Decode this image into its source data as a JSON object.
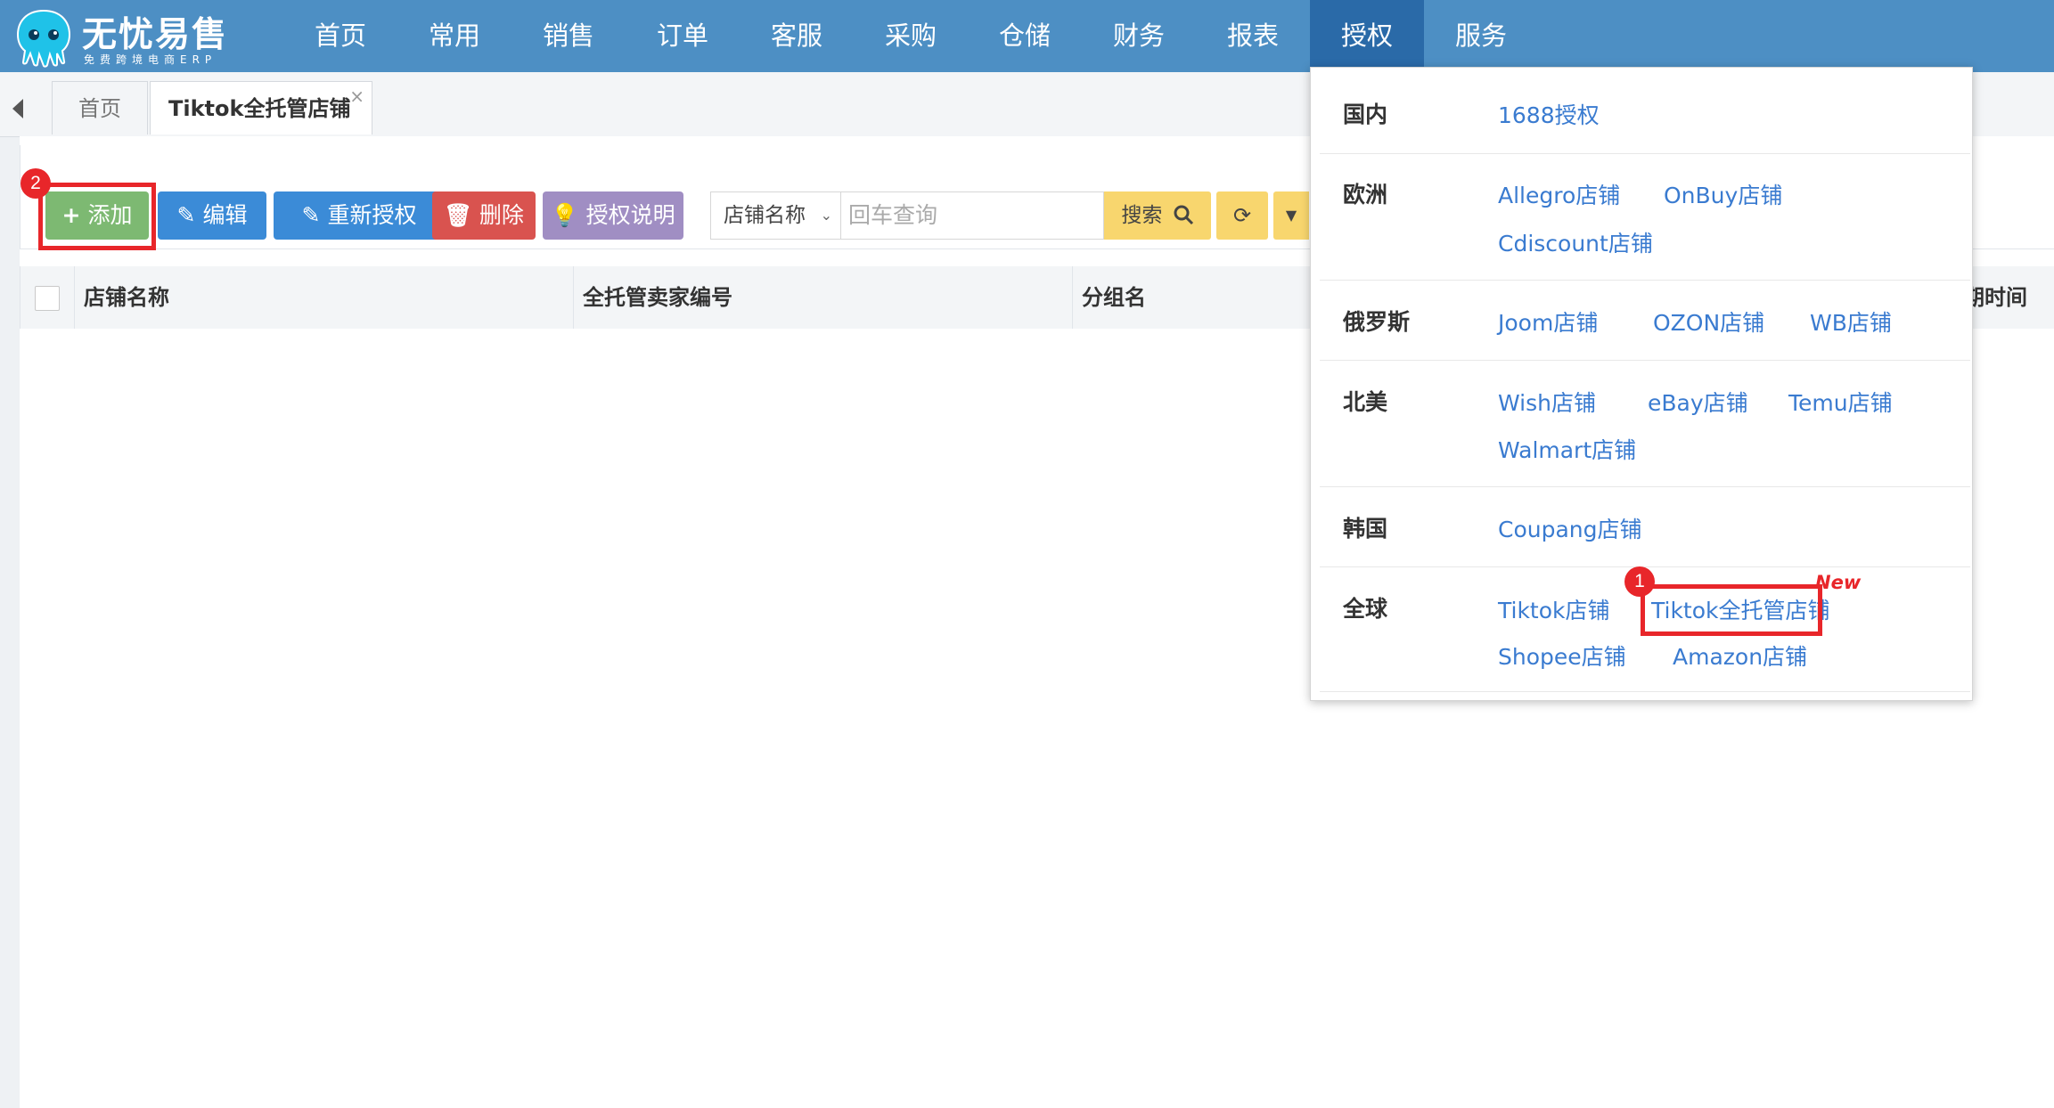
{
  "brand": {
    "title": "无忧易售",
    "subtitle": "免费跨境电商ERP"
  },
  "nav": [
    {
      "label": "首页"
    },
    {
      "label": "常用"
    },
    {
      "label": "销售"
    },
    {
      "label": "订单"
    },
    {
      "label": "客服"
    },
    {
      "label": "采购"
    },
    {
      "label": "仓储"
    },
    {
      "label": "财务"
    },
    {
      "label": "报表"
    },
    {
      "label": "授权",
      "active": true
    },
    {
      "label": "服务"
    }
  ],
  "tabs": {
    "home": "首页",
    "current": "Tiktok全托管店铺",
    "close": "×"
  },
  "toolbar": {
    "add": "添加",
    "edit": "编辑",
    "reauth": "重新授权",
    "delete": "删除",
    "auth_help": "授权说明",
    "search_field": "店铺名称",
    "search_placeholder": "回车查询",
    "search": "搜索"
  },
  "table": {
    "columns": [
      "店铺名称",
      "全托管卖家编号",
      "分组名",
      "期时间"
    ]
  },
  "badges": {
    "step1": "1",
    "step2": "2"
  },
  "auth_menu": {
    "new_tag": "New",
    "rows": [
      {
        "region": "国内",
        "links": [
          "1688授权"
        ]
      },
      {
        "region": "欧洲",
        "links": [
          "Allegro店铺",
          "OnBuy店铺",
          "Cdiscount店铺"
        ]
      },
      {
        "region": "俄罗斯",
        "links": [
          "Joom店铺",
          "OZON店铺",
          "WB店铺"
        ]
      },
      {
        "region": "北美",
        "links": [
          "Wish店铺",
          "eBay店铺",
          "Temu店铺",
          "Walmart店铺"
        ]
      },
      {
        "region": "韩国",
        "links": [
          "Coupang店铺"
        ]
      },
      {
        "region": "全球",
        "links": [
          "Tiktok店铺",
          "Tiktok全托管店铺",
          "Shopee店铺",
          "Amazon店铺"
        ]
      }
    ]
  },
  "colors": {
    "header": "#4d8fc4",
    "active_nav": "#2a6aa8",
    "link": "#3a7bd0",
    "highlight": "#e8262a"
  }
}
